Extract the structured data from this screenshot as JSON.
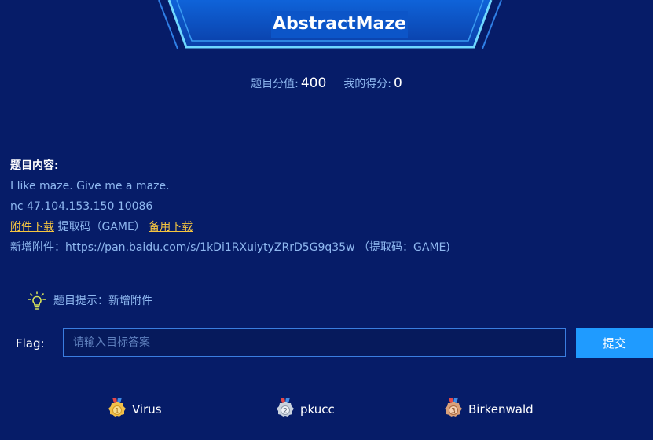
{
  "challenge": {
    "title": "AbstractMaze",
    "score_label": "题目分值:",
    "score_value": "400",
    "my_score_label": "我的得分:",
    "my_score_value": "0"
  },
  "content": {
    "heading": "题目内容:",
    "line1": "I like maze. Give me a maze.",
    "line2": "nc 47.104.153.150 10086",
    "download_link": "附件下载",
    "extract_code": " 提取码（GAME）",
    "backup_link": "备用下载",
    "new_attachment": "新增附件：https://pan.baidu.com/s/1kDi1RXuiytyZRrD5G9q35w （提取码：GAME)"
  },
  "hint": {
    "icon": "lightbulb-icon",
    "text": "题目提示：新增附件"
  },
  "flag": {
    "label": "Flag:",
    "placeholder": "请输入目标答案",
    "submit_label": "提交"
  },
  "ranking": [
    {
      "place": "1",
      "name": "Virus"
    },
    {
      "place": "2",
      "name": "pkucc"
    },
    {
      "place": "3",
      "name": "Birkenwald"
    }
  ],
  "colors": {
    "background": "#061c68",
    "accent": "#1f9bff",
    "link": "#f5c540",
    "gold": "#f2c049",
    "silver": "#c9d2de",
    "bronze": "#d9a07a"
  }
}
